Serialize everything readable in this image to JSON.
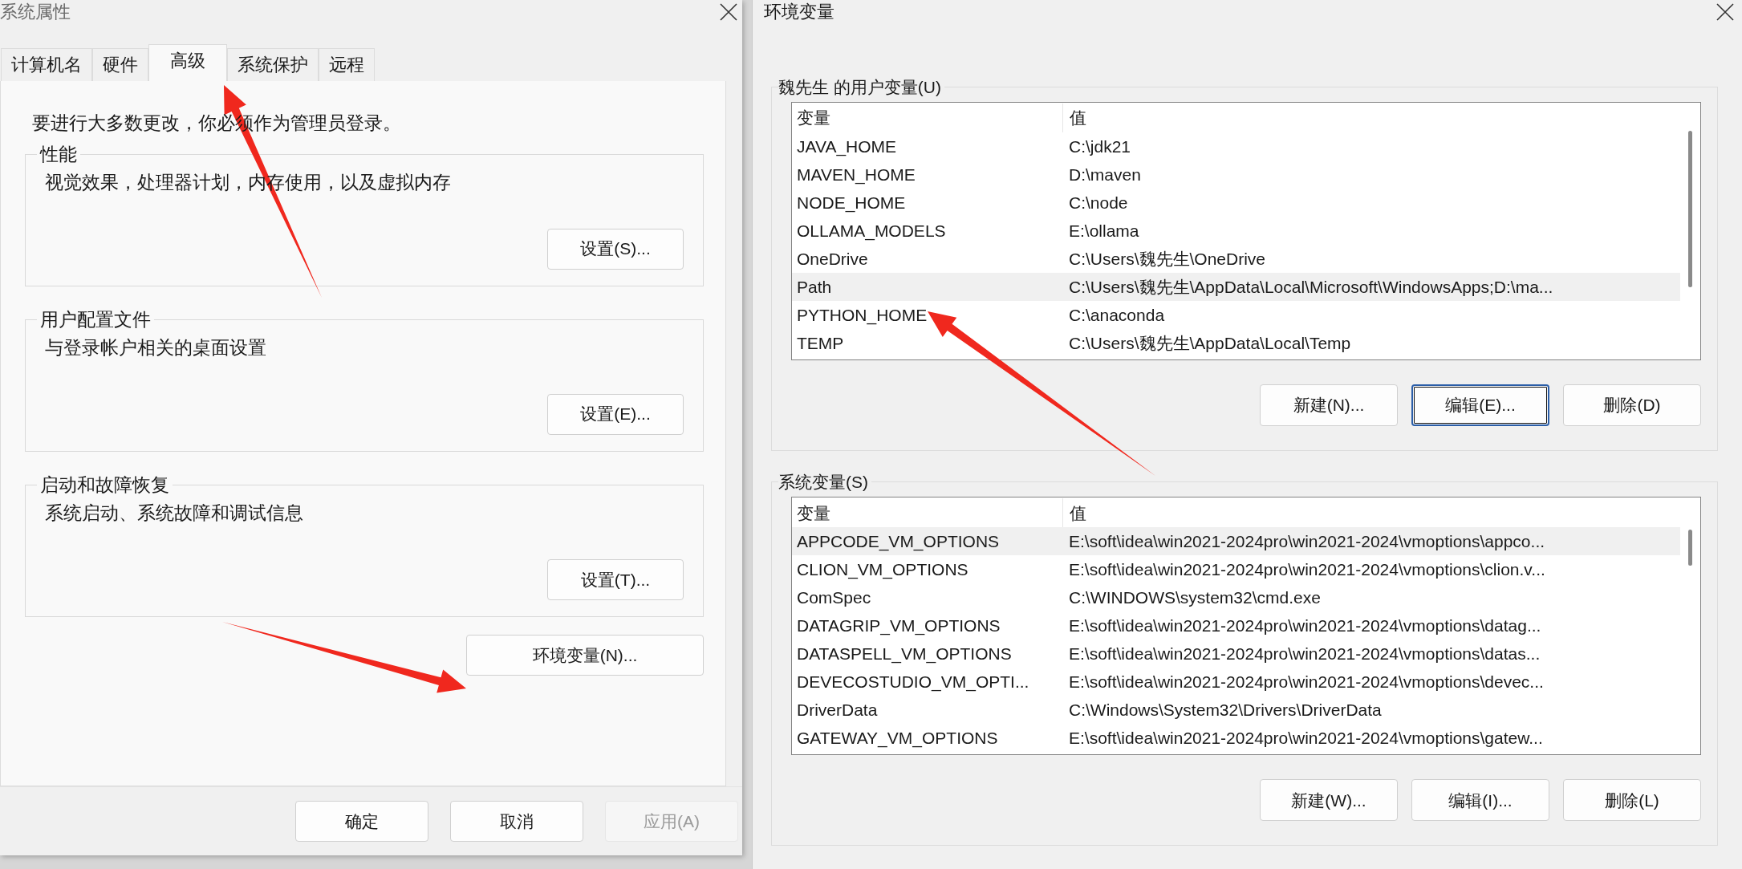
{
  "left_window": {
    "title": "系统属性",
    "tabs": [
      {
        "label": "计算机名",
        "selected": false
      },
      {
        "label": "硬件",
        "selected": false
      },
      {
        "label": "高级",
        "selected": true
      },
      {
        "label": "系统保护",
        "selected": false
      },
      {
        "label": "远程",
        "selected": false
      }
    ],
    "notice": "要进行大多数更改，你必须作为管理员登录。",
    "groups": [
      {
        "title": "性能",
        "description": "视觉效果，处理器计划，内存使用，以及虚拟内存",
        "button": "设置(S)..."
      },
      {
        "title": "用户配置文件",
        "description": "与登录帐户相关的桌面设置",
        "button": "设置(E)..."
      },
      {
        "title": "启动和故障恢复",
        "description": "系统启动、系统故障和调试信息",
        "button": "设置(T)..."
      }
    ],
    "env_button": "环境变量(N)...",
    "footer_buttons": [
      {
        "label": "确定",
        "disabled": false
      },
      {
        "label": "取消",
        "disabled": false
      },
      {
        "label": "应用(A)",
        "disabled": true
      }
    ]
  },
  "right_window": {
    "title": "环境变量",
    "sections": [
      {
        "title": "魏先生 的用户变量(U)",
        "columns": [
          "变量",
          "值"
        ],
        "rows": [
          {
            "name": "JAVA_HOME",
            "value": "C:\\jdk21",
            "selected": false
          },
          {
            "name": "MAVEN_HOME",
            "value": "D:\\maven",
            "selected": false
          },
          {
            "name": "NODE_HOME",
            "value": "C:\\node",
            "selected": false
          },
          {
            "name": "OLLAMA_MODELS",
            "value": "E:\\ollama",
            "selected": false
          },
          {
            "name": "OneDrive",
            "value": "C:\\Users\\魏先生\\OneDrive",
            "selected": false
          },
          {
            "name": "Path",
            "value": "C:\\Users\\魏先生\\AppData\\Local\\Microsoft\\WindowsApps;D:\\ma...",
            "selected": true
          },
          {
            "name": "PYTHON_HOME",
            "value": "C:\\anaconda",
            "selected": false
          },
          {
            "name": "TEMP",
            "value": "C:\\Users\\魏先生\\AppData\\Local\\Temp",
            "selected": false
          }
        ],
        "buttons": [
          {
            "label": "新建(N)...",
            "focused": false
          },
          {
            "label": "编辑(E)...",
            "focused": true
          },
          {
            "label": "删除(D)",
            "focused": false
          }
        ]
      },
      {
        "title": "系统变量(S)",
        "columns": [
          "变量",
          "值"
        ],
        "rows": [
          {
            "name": "APPCODE_VM_OPTIONS",
            "value": "E:\\soft\\idea\\win2021-2024pro\\win2021-2024\\vmoptions\\appco...",
            "selected": true
          },
          {
            "name": "CLION_VM_OPTIONS",
            "value": "E:\\soft\\idea\\win2021-2024pro\\win2021-2024\\vmoptions\\clion.v...",
            "selected": false
          },
          {
            "name": "ComSpec",
            "value": "C:\\WINDOWS\\system32\\cmd.exe",
            "selected": false
          },
          {
            "name": "DATAGRIP_VM_OPTIONS",
            "value": "E:\\soft\\idea\\win2021-2024pro\\win2021-2024\\vmoptions\\datag...",
            "selected": false
          },
          {
            "name": "DATASPELL_VM_OPTIONS",
            "value": "E:\\soft\\idea\\win2021-2024pro\\win2021-2024\\vmoptions\\datas...",
            "selected": false
          },
          {
            "name": "DEVECOSTUDIO_VM_OPTI...",
            "value": "E:\\soft\\idea\\win2021-2024pro\\win2021-2024\\vmoptions\\devec...",
            "selected": false
          },
          {
            "name": "DriverData",
            "value": "C:\\Windows\\System32\\Drivers\\DriverData",
            "selected": false
          },
          {
            "name": "GATEWAY_VM_OPTIONS",
            "value": "E:\\soft\\idea\\win2021-2024pro\\win2021-2024\\vmoptions\\gatew...",
            "selected": false
          }
        ],
        "buttons": [
          {
            "label": "新建(W)...",
            "focused": false
          },
          {
            "label": "编辑(I)...",
            "focused": false
          },
          {
            "label": "删除(L)",
            "focused": false
          }
        ]
      }
    ]
  }
}
